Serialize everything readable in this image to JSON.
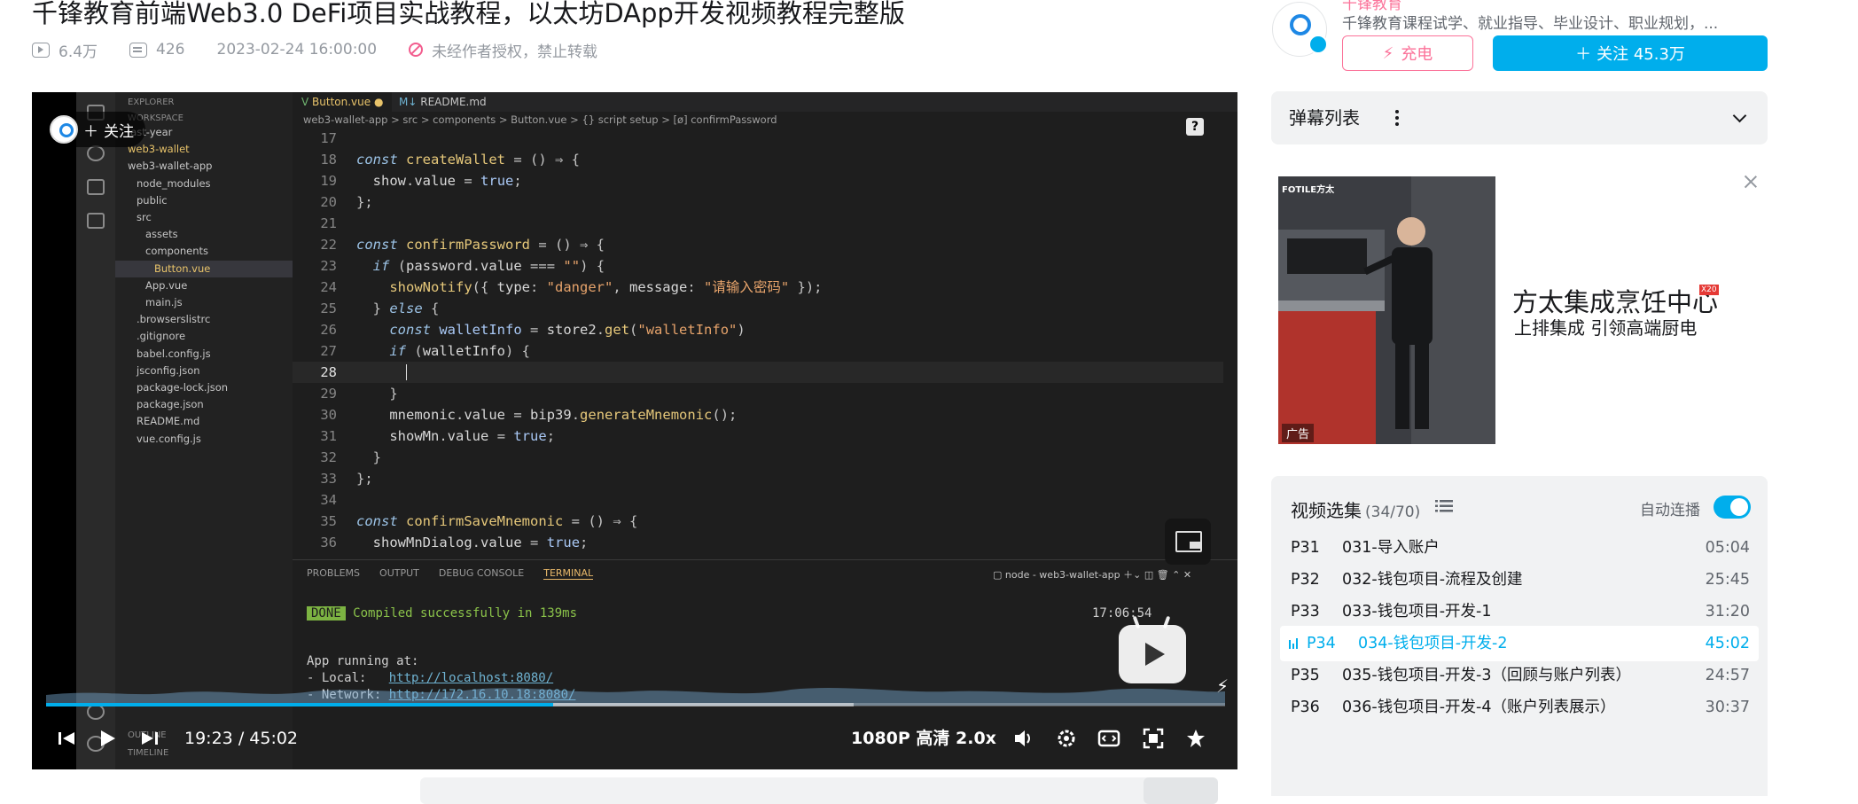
{
  "video": {
    "title": "千锋教育前端Web3.0 DeFi项目实战教程，以太坊DApp开发视频教程完整版",
    "views": "6.4万",
    "danmaku_count": "426",
    "publish_time": "2023-02-24 16:00:00",
    "copyright_notice": "未经作者授权，禁止转载"
  },
  "player": {
    "follow_overlay": "关注",
    "help_glyph": "?",
    "time_current": "19:23",
    "time_separator": "/",
    "time_total": "45:02",
    "quality": "1080P 高清",
    "speed": "2.0x",
    "progress": 0.43,
    "buffered": 0.685
  },
  "editor": {
    "explorer_title": "EXPLORER",
    "workspace_label": "WORKSPACE",
    "tree": [
      {
        "name": "last-year",
        "indent": 0
      },
      {
        "name": "web3-wallet",
        "indent": 0,
        "dirty": true
      },
      {
        "name": "web3-wallet-app",
        "indent": 0
      },
      {
        "name": "node_modules",
        "indent": 1
      },
      {
        "name": "public",
        "indent": 1
      },
      {
        "name": "src",
        "indent": 1
      },
      {
        "name": "assets",
        "indent": 2
      },
      {
        "name": "components",
        "indent": 2
      },
      {
        "name": "Button.vue",
        "indent": 3,
        "selected": true
      },
      {
        "name": "App.vue",
        "indent": 2
      },
      {
        "name": "main.js",
        "indent": 2
      },
      {
        "name": ".browserslistrc",
        "indent": 1
      },
      {
        "name": ".gitignore",
        "indent": 1
      },
      {
        "name": "babel.config.js",
        "indent": 1
      },
      {
        "name": "jsconfig.json",
        "indent": 1
      },
      {
        "name": "package-lock.json",
        "indent": 1
      },
      {
        "name": "package.json",
        "indent": 1
      },
      {
        "name": "README.md",
        "indent": 1
      },
      {
        "name": "vue.config.js",
        "indent": 1
      }
    ],
    "outline_label": "OUTLINE",
    "timeline_label": "TIMELINE",
    "tab_active": "Button.vue",
    "tab_other": "README.md",
    "breadcrumb": "web3-wallet-app > src > components > Button.vue > {} script setup > [ø] confirmPassword",
    "terminal_tabs": [
      "PROBLEMS",
      "OUTPUT",
      "DEBUG CONSOLE",
      "TERMINAL"
    ],
    "terminal_active": "TERMINAL",
    "terminal_session": "node - web3-wallet-app",
    "terminal_done": "DONE",
    "terminal_compiled": "Compiled successfully in 139ms",
    "terminal_clock": "17:06:54",
    "terminal_running": "App running at:",
    "terminal_local_label": "- Local:   ",
    "terminal_local_url": "http://localhost:8080/",
    "terminal_network_label": "- Network: ",
    "terminal_network_url": "http://172.16.10.18:8080/"
  },
  "uploader": {
    "name": "千锋教育",
    "description": "千锋教育课程试学、就业指导、毕业设计、职业规划，...",
    "charge_label": "充电",
    "follow_label": "关注 45.3万"
  },
  "danmu_panel": {
    "label": "弹幕列表"
  },
  "ad": {
    "brand": "FOTILE方太",
    "title": "方太集成烹饪中心",
    "tag": "X20",
    "subtitle": "上排集成 引领高端厨电",
    "ad_label": "广告"
  },
  "playlist": {
    "title": "视频选集",
    "count": "(34/70)",
    "autoplay_label": "自动连播",
    "autoplay_on": true,
    "items": [
      {
        "no": "P31",
        "name": "031-导入账户",
        "dur": "05:04"
      },
      {
        "no": "P32",
        "name": "032-钱包项目-流程及创建",
        "dur": "25:45"
      },
      {
        "no": "P33",
        "name": "033-钱包项目-开发-1",
        "dur": "31:20"
      },
      {
        "no": "P34",
        "name": "034-钱包项目-开发-2",
        "dur": "45:02",
        "active": true
      },
      {
        "no": "P35",
        "name": "035-钱包项目-开发-3（回顾与账户列表）",
        "dur": "24:57"
      },
      {
        "no": "P36",
        "name": "036-钱包项目-开发-4（账户列表展示）",
        "dur": "30:37"
      }
    ]
  },
  "colors": {
    "accent": "#00aeec",
    "pink": "#fb7299",
    "panel": "#f1f2f3"
  }
}
